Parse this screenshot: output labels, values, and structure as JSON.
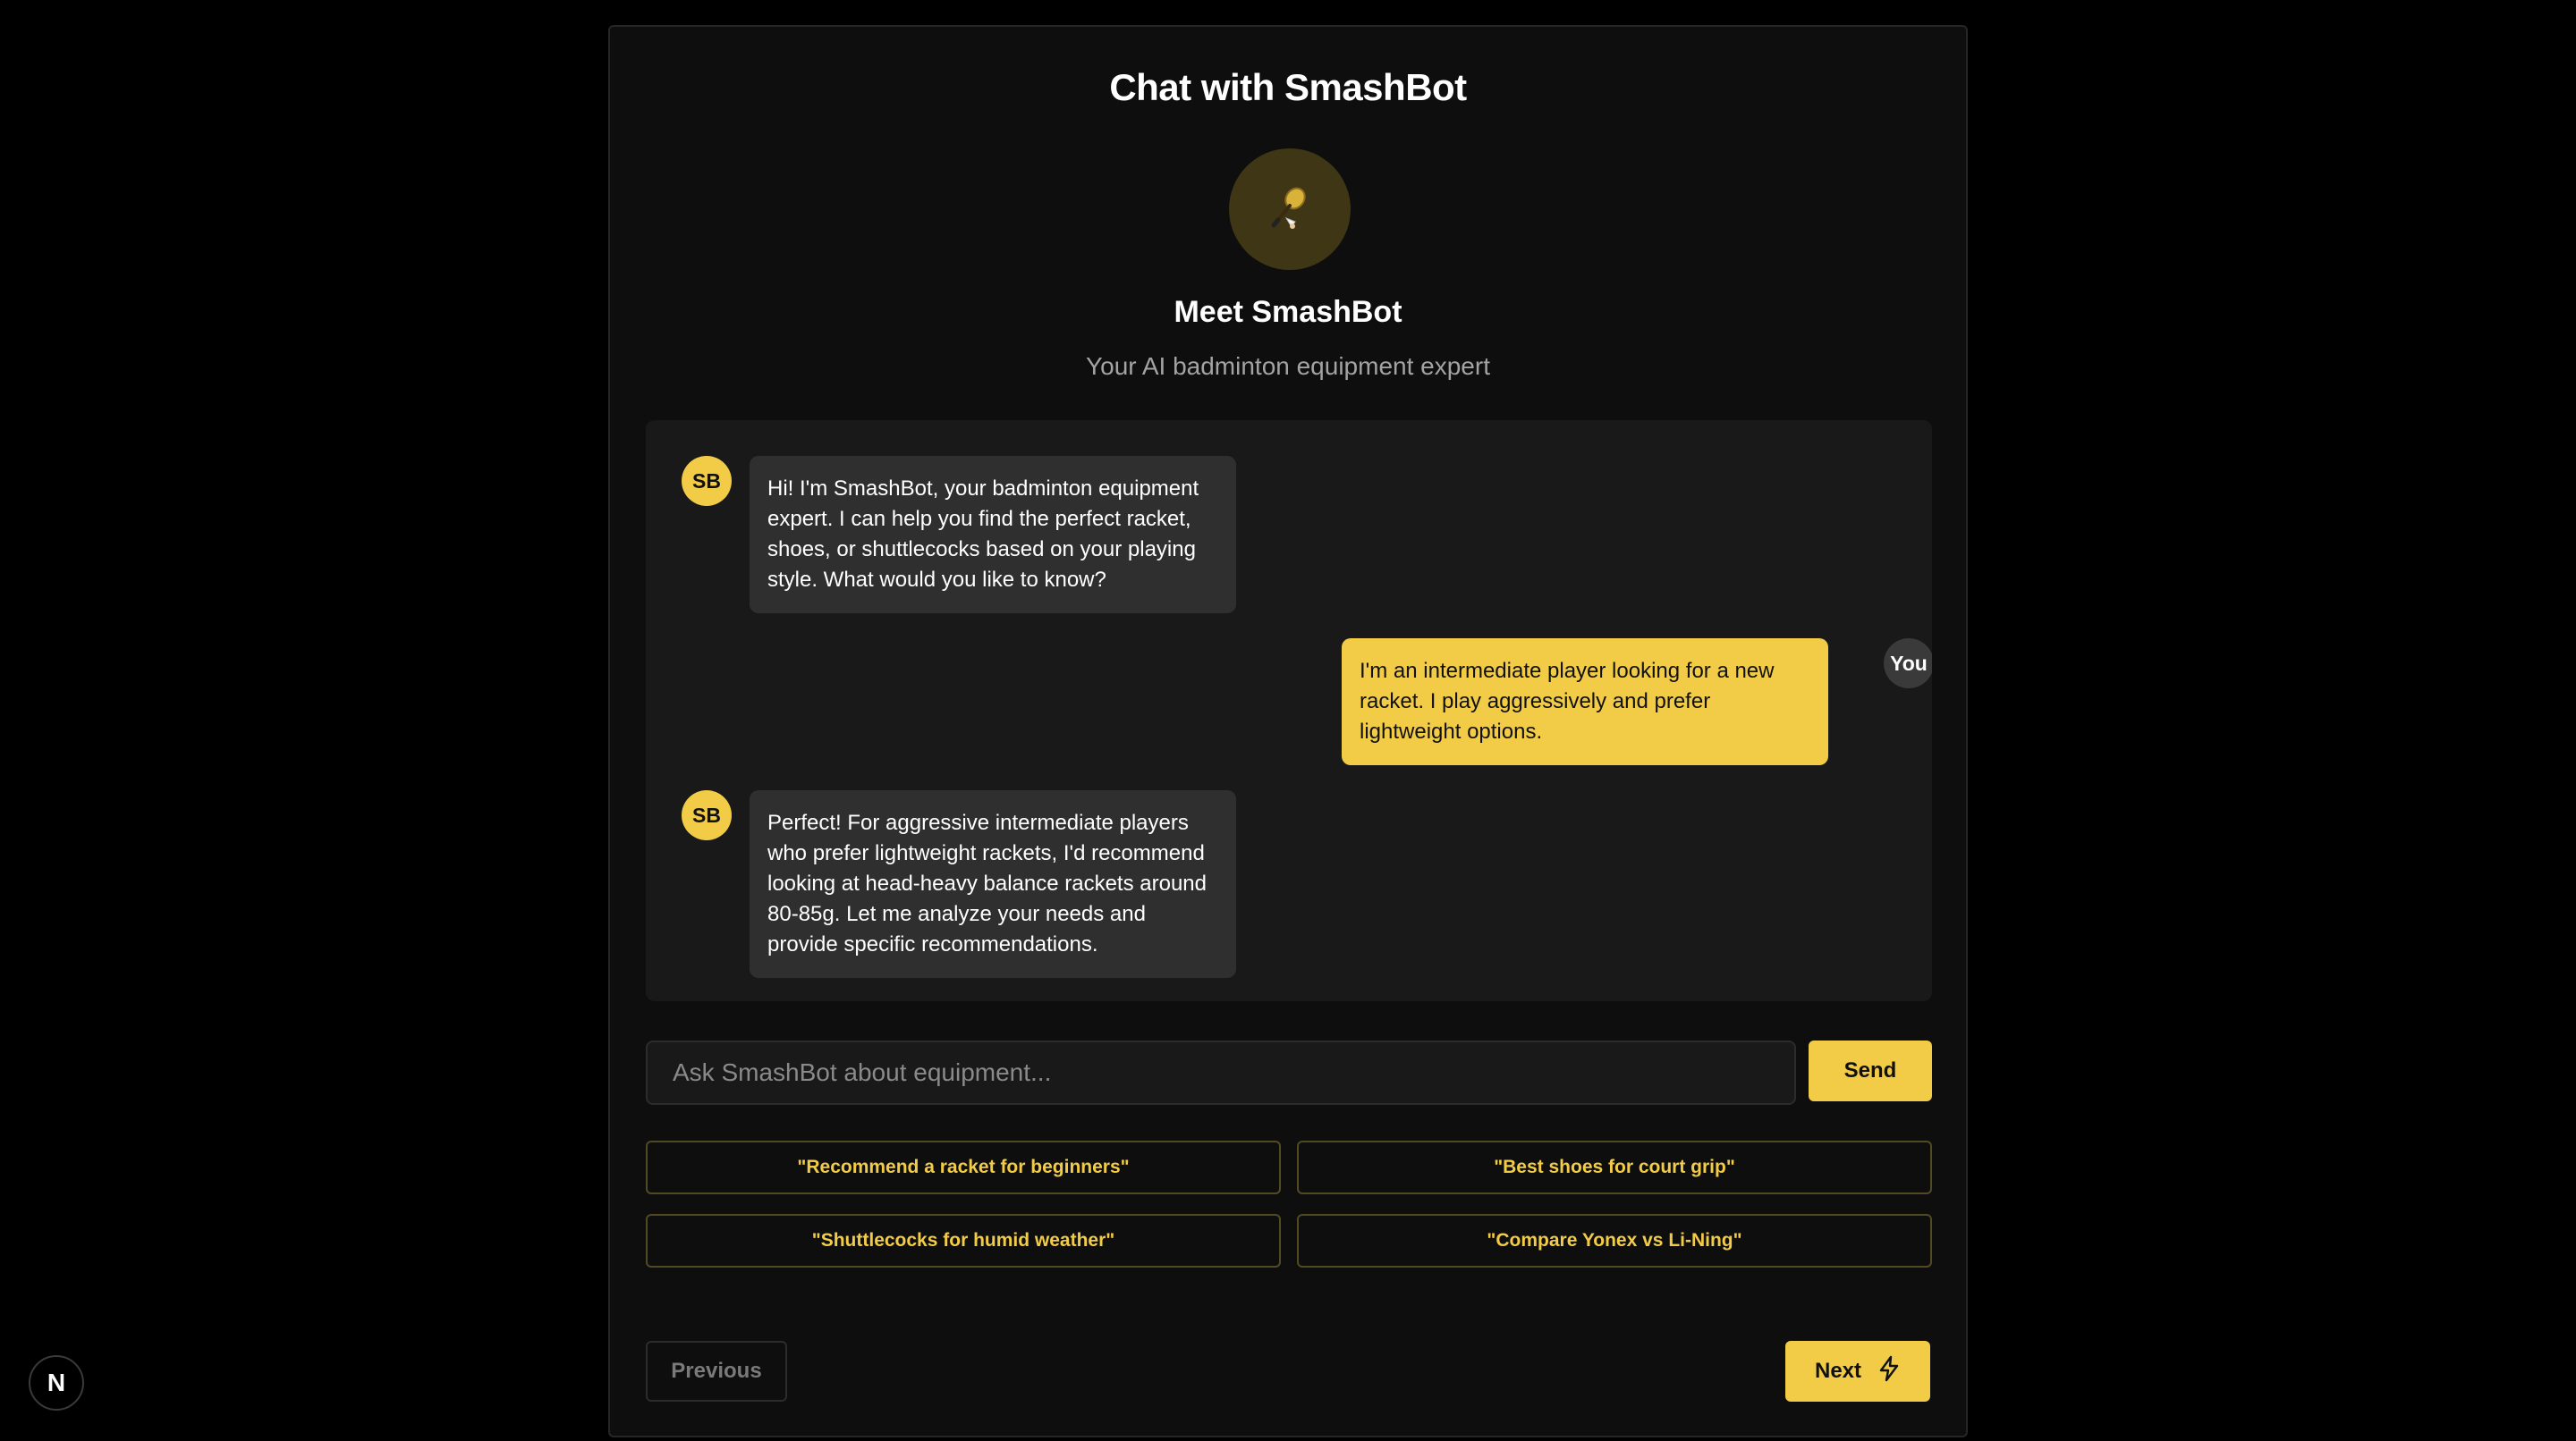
{
  "app": {
    "title": "Chat with SmashBot",
    "bot_name": "Meet SmashBot",
    "bot_tagline": "Your AI badminton equipment expert",
    "bot_icon": "badminton-racket-icon",
    "accent_color": "#f2cc47"
  },
  "messages": [
    {
      "sender": "bot",
      "avatar": "SB",
      "text": "Hi! I'm SmashBot, your badminton equipment expert. I can help you find the perfect racket, shoes, or shuttlecocks based on your playing style. What would you like to know?"
    },
    {
      "sender": "user",
      "avatar": "You",
      "text": "I'm an intermediate player looking for a new racket. I play aggressively and prefer lightweight options."
    },
    {
      "sender": "bot",
      "avatar": "SB",
      "text": "Perfect! For aggressive intermediate players who prefer lightweight rackets, I'd recommend looking at head-heavy balance rackets around 80-85g. Let me analyze your needs and provide specific recommendations."
    }
  ],
  "input": {
    "value": "",
    "placeholder": "Ask SmashBot about equipment...",
    "send_label": "Send"
  },
  "suggestions": [
    "\"Recommend a racket for beginners\"",
    "\"Best shoes for court grip\"",
    "\"Shuttlecocks for humid weather\"",
    "\"Compare Yonex vs Li-Ning\""
  ],
  "navigation": {
    "previous_label": "Previous",
    "next_label": "Next",
    "next_icon": "lightning-bolt-icon"
  },
  "dev_badge": {
    "letter": "N"
  }
}
